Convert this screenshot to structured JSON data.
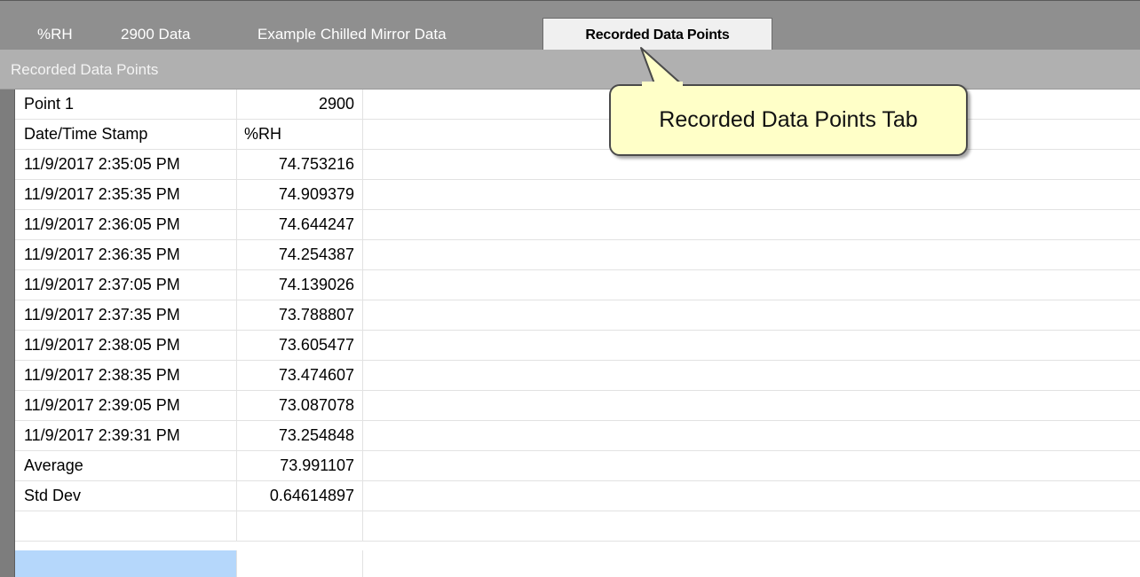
{
  "tabs": [
    {
      "label": "%RH",
      "active": false
    },
    {
      "label": "2900 Data",
      "active": false
    },
    {
      "label": "Example Chilled Mirror Data",
      "active": false
    },
    {
      "label": "Recorded Data Points",
      "active": true
    }
  ],
  "header": {
    "title": "Recorded Data Points"
  },
  "grid": {
    "rows": [
      {
        "col1": "Point 1",
        "col2": "2900"
      },
      {
        "col1": "Date/Time Stamp",
        "col2": "%RH"
      },
      {
        "col1": "11/9/2017 2:35:05 PM",
        "col2": "74.753216"
      },
      {
        "col1": "11/9/2017 2:35:35 PM",
        "col2": "74.909379"
      },
      {
        "col1": "11/9/2017 2:36:05 PM",
        "col2": "74.644247"
      },
      {
        "col1": "11/9/2017 2:36:35 PM",
        "col2": "74.254387"
      },
      {
        "col1": "11/9/2017 2:37:05 PM",
        "col2": "74.139026"
      },
      {
        "col1": "11/9/2017 2:37:35 PM",
        "col2": "73.788807"
      },
      {
        "col1": "11/9/2017 2:38:05 PM",
        "col2": "73.605477"
      },
      {
        "col1": "11/9/2017 2:38:35 PM",
        "col2": "73.474607"
      },
      {
        "col1": "11/9/2017 2:39:05 PM",
        "col2": "73.087078"
      },
      {
        "col1": "11/9/2017 2:39:31 PM",
        "col2": "73.254848"
      },
      {
        "col1": "Average",
        "col2": "73.991107"
      },
      {
        "col1": "Std Dev",
        "col2": "0.64614897"
      },
      {
        "col1": "",
        "col2": ""
      },
      {
        "col1": "",
        "col2": ""
      }
    ]
  },
  "callout": {
    "text": "Recorded Data Points Tab"
  },
  "colors": {
    "tab_bar": "#8f8f8f",
    "active_tab": "#f0f0f0",
    "header_bar": "#b0b0b0",
    "selection": "#b5d7fb",
    "callout_fill": "#ffffc8"
  }
}
